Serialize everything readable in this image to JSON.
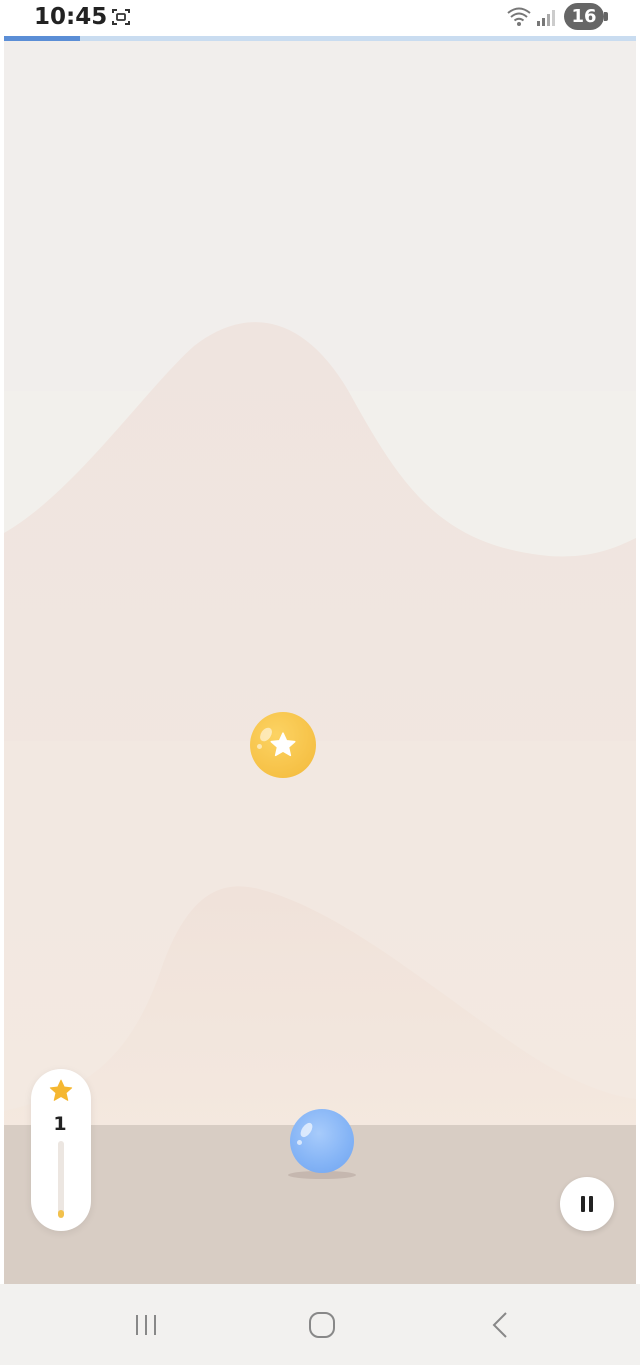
{
  "status_bar": {
    "time": "10:45",
    "battery": "16",
    "icons": [
      "screenshot-icon",
      "wifi-icon",
      "signal-icon"
    ]
  },
  "level_progress": {
    "fraction": 0.12,
    "color": "#5b8ed6",
    "track_color": "#c9dcf0"
  },
  "hud": {
    "star_count": "1",
    "star_meter_fraction": 0.1
  },
  "colors": {
    "sky": "#f1eeec",
    "ground": "#d8cdc4",
    "coin": "#f6c146",
    "player": "#86b5f6"
  },
  "nav_bar": {
    "icons": [
      "recents-icon",
      "home-icon",
      "back-icon"
    ]
  }
}
